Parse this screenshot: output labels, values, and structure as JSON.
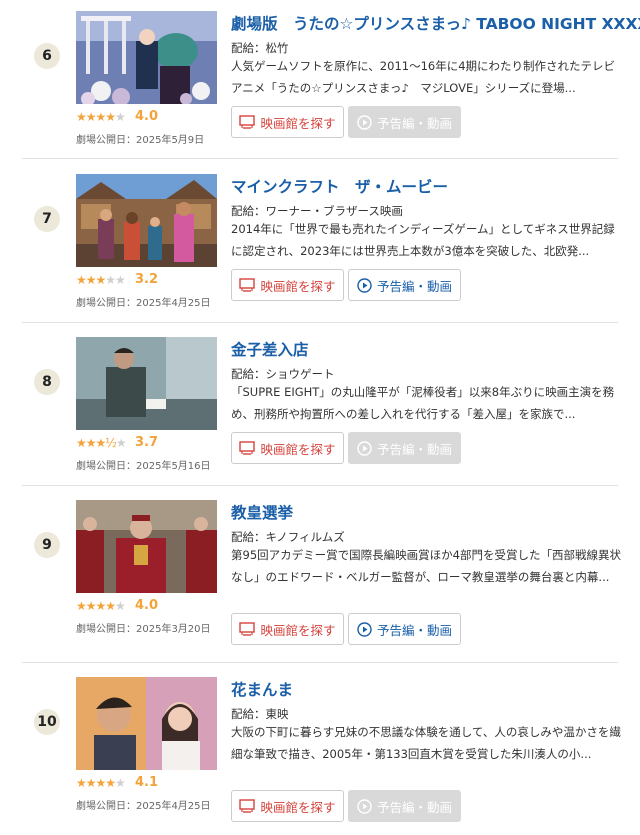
{
  "labels": {
    "theater_button": "映画館を探す",
    "trailer_button": "予告編・動画"
  },
  "colors": {
    "title": "#1a5fa8",
    "star": "#f2a33a",
    "theater_button_text": "#d6433c",
    "trailer_button_text": "#1a5fa8",
    "trailer_disabled_bg": "#d9d9d9"
  },
  "movies": [
    {
      "rank": "6",
      "title": "劇場版　うたの☆プリンスさまっ♪ TABOO NIGHT XXXX",
      "distributor": "配給：松竹",
      "description": "人気ゲームソフトを原作に、2011～16年に4期にわたり制作されたテレビアニメ「うたの☆プリンスさまっ♪　マジLOVE」シリーズに登場...",
      "rating": 4.0,
      "score": "4.0",
      "release": "劇場公開日：2025年5月9日",
      "trailer_available": false
    },
    {
      "rank": "7",
      "title": "マインクラフト　ザ・ムービー",
      "distributor": "配給：ワーナー・ブラザース映画",
      "description": "2014年に「世界で最も売れたインディーズゲーム」としてギネス世界記録に認定され、2023年には世界売上本数が3億本を突破した、北欧発...",
      "rating": 3.2,
      "score": "3.2",
      "release": "劇場公開日：2025年4月25日",
      "trailer_available": true
    },
    {
      "rank": "8",
      "title": "金子差入店",
      "distributor": "配給：ショウゲート",
      "description": "「SUPRE EIGHT」の丸山隆平が「泥棒役者」以来8年ぶりに映画主演を務め、刑務所や拘置所への差し入れを代行する「差入屋」を家族で...",
      "rating": 3.7,
      "score": "3.7",
      "release": "劇場公開日：2025年5月16日",
      "trailer_available": false
    },
    {
      "rank": "9",
      "title": "教皇選挙",
      "distributor": "配給：キノフィルムズ",
      "description": "第95回アカデミー賞で国際長編映画賞ほか4部門を受賞した「西部戦線異状なし」のエドワード・ベルガー監督が、ローマ教皇選挙の舞台裏と内幕...",
      "rating": 4.0,
      "score": "4.0",
      "release": "劇場公開日：2025年3月20日",
      "trailer_available": true
    },
    {
      "rank": "10",
      "title": "花まんま",
      "distributor": "配給：東映",
      "description": "大阪の下町に暮らす兄妹の不思議な体験を通して、人の哀しみや温かさを繊細な筆致で描き、2005年・第133回直木賞を受賞した朱川湊人の小...",
      "rating": 4.1,
      "score": "4.1",
      "release": "劇場公開日：2025年4月25日",
      "trailer_available": false
    }
  ]
}
